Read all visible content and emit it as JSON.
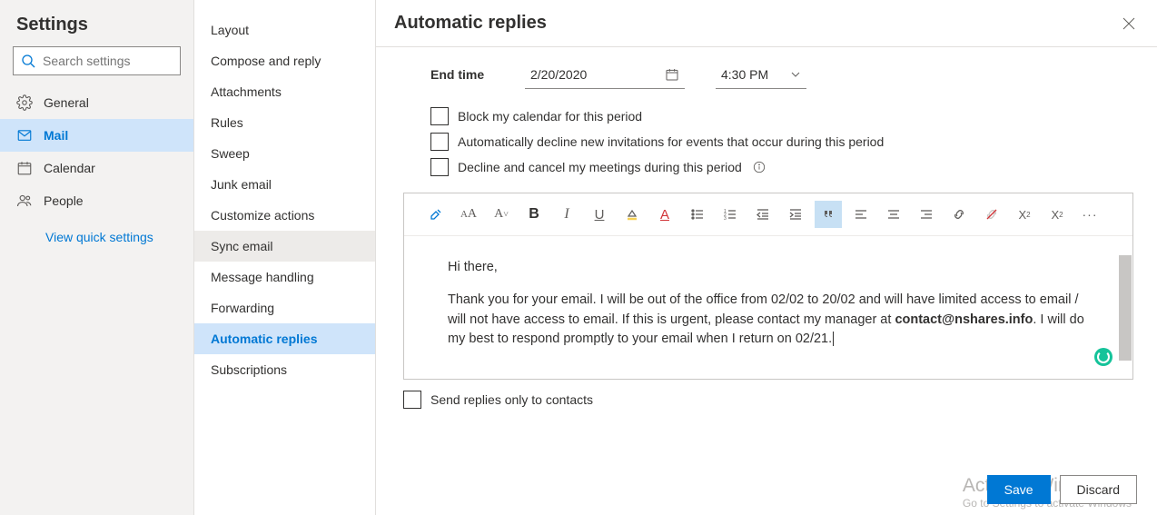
{
  "sidebar": {
    "title": "Settings",
    "search_placeholder": "Search settings",
    "items": [
      {
        "label": "General"
      },
      {
        "label": "Mail"
      },
      {
        "label": "Calendar"
      },
      {
        "label": "People"
      }
    ],
    "quick_settings": "View quick settings"
  },
  "mid": {
    "items": [
      "Layout",
      "Compose and reply",
      "Attachments",
      "Rules",
      "Sweep",
      "Junk email",
      "Customize actions",
      "Sync email",
      "Message handling",
      "Forwarding",
      "Automatic replies",
      "Subscriptions"
    ]
  },
  "panel": {
    "title": "Automatic replies",
    "end_time_label": "End time",
    "end_date": "2/20/2020",
    "end_time": "4:30 PM",
    "opt_block": "Block my calendar for this period",
    "opt_decline_new": "Automatically decline new invitations for events that occur during this period",
    "opt_decline_cancel": "Decline and cancel my meetings during this period",
    "message": {
      "greeting": "Hi there,",
      "body_pre": "Thank you for your email. I will be out of the office from 02/02 to 20/02 and will have limited access to email / will not have access to email. If this is urgent, please contact my manager at ",
      "email": "contact@nshares.info",
      "body_post": ". I will do my best to respond promptly to your email when I return on 02/21."
    },
    "send_contacts_only": "Send replies only to contacts",
    "save": "Save",
    "discard": "Discard"
  },
  "watermark": {
    "line1": "Activate Windows",
    "line2": "Go to Settings to activate Windows"
  }
}
